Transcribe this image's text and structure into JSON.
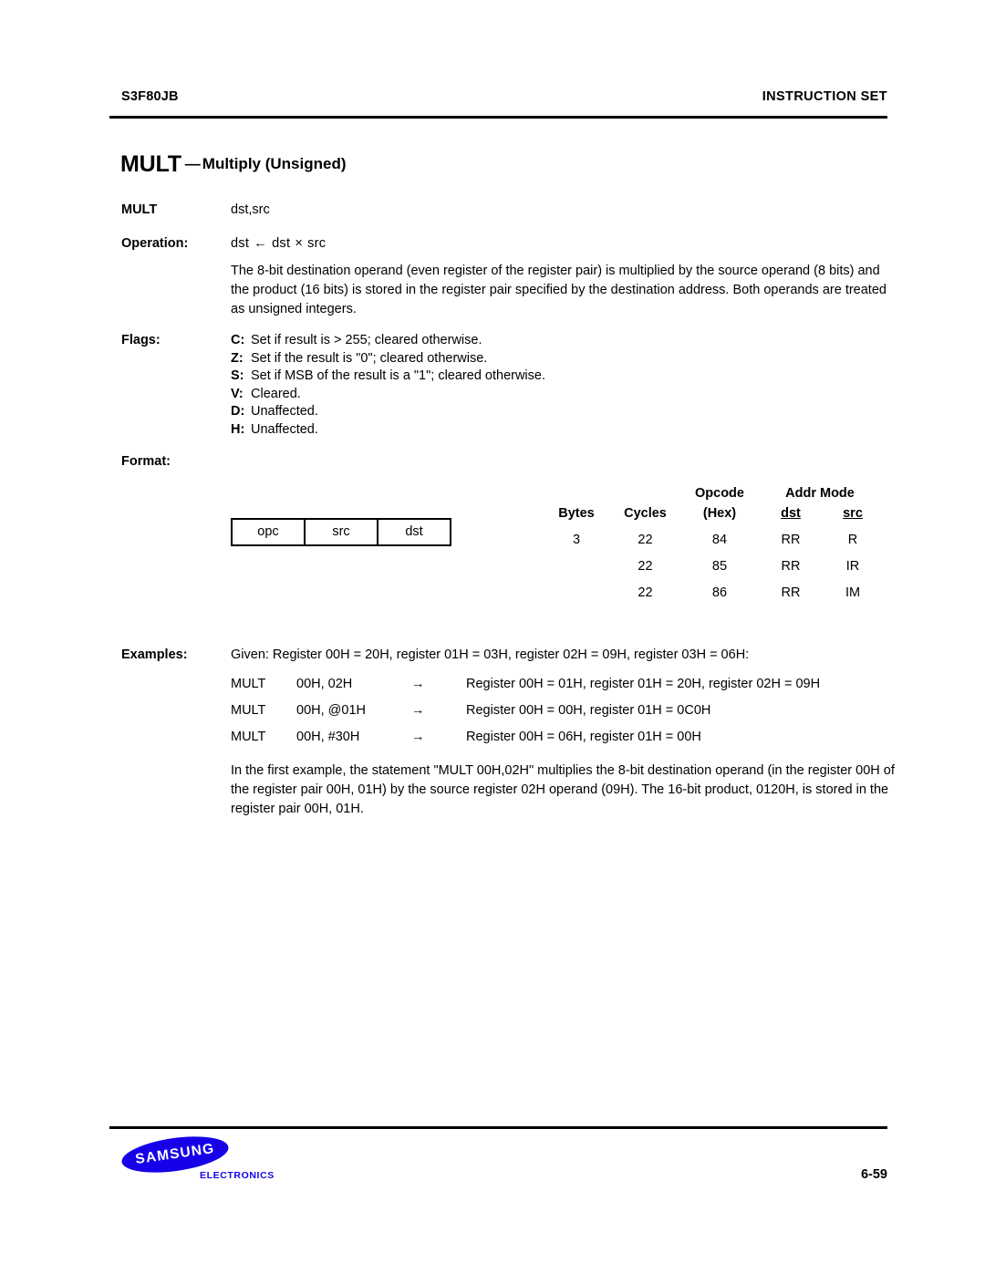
{
  "header": {
    "left": "S3F80JB",
    "right": "INSTRUCTION SET"
  },
  "title": {
    "mnemonic": "MULT",
    "dash": "—",
    "longname": "Multiply (Unsigned)"
  },
  "syntax": {
    "label": "MULT",
    "operands": "dst,src"
  },
  "operation": {
    "label": "Operation:",
    "dst": "dst",
    "assign_symbol": "←",
    "left_operand": "dst",
    "mul_symbol": "×",
    "right_operand": "src",
    "description": "The 8-bit destination operand (even register of the register pair) is multiplied by the source operand (8 bits) and the product (16 bits) is stored in the register pair specified by the destination address. Both operands are treated as unsigned integers."
  },
  "flags": {
    "label": "Flags:",
    "items": [
      {
        "key": "C:",
        "text": "Set if result is  > 255; cleared otherwise."
      },
      {
        "key": "Z:",
        "text": "Set if the result is \"0\"; cleared otherwise."
      },
      {
        "key": "S:",
        "text": "Set if MSB of the result is a \"1\"; cleared otherwise."
      },
      {
        "key": "V:",
        "text": "Cleared."
      },
      {
        "key": "D:",
        "text": "Unaffected."
      },
      {
        "key": "H:",
        "text": "Unaffected."
      }
    ]
  },
  "format": {
    "label": "Format:",
    "opcode_box": [
      "opc",
      "src",
      "dst"
    ],
    "table": {
      "headers": {
        "bytes": "Bytes",
        "cycles": "Cycles",
        "opcode": "Opcode",
        "opcode_sub": "(Hex)",
        "addr_mode": "Addr Mode",
        "dst": "dst",
        "src": "src"
      },
      "rows": [
        {
          "bytes": "3",
          "cycles": "22",
          "opcode": "84",
          "dst": "RR",
          "src": "R"
        },
        {
          "bytes": "",
          "cycles": "22",
          "opcode": "85",
          "dst": "RR",
          "src": "IR"
        },
        {
          "bytes": "",
          "cycles": "22",
          "opcode": "86",
          "dst": "RR",
          "src": "IM"
        }
      ]
    }
  },
  "examples": {
    "label": "Examples:",
    "given": "Given:  Register 00H  =  20H, register 01H  =  03H, register 02H  =  09H, register 03H  =  06H:",
    "lines": [
      {
        "mnemonic": "MULT",
        "operands": "00H, 02H",
        "arrow": "→",
        "result": "Register 00H  =  01H, register 01H  =  20H, register 02H  =  09H"
      },
      {
        "mnemonic": "MULT",
        "operands": "00H, @01H",
        "arrow": "→",
        "result": "Register 00H  =  00H, register 01H  =  0C0H"
      },
      {
        "mnemonic": "MULT",
        "operands": "00H, #30H",
        "arrow": "→",
        "result": "Register 00H  =  06H, register 01H =  00H"
      }
    ],
    "closing": "In the first example, the statement \"MULT  00H,02H\" multiplies the 8-bit destination operand (in the register 00H of the register pair 00H, 01H) by the source register 02H operand (09H). The 16-bit product, 0120H, is stored in the register pair 00H, 01H."
  },
  "footer": {
    "logo_text": "SAMSUNG",
    "logo_subtext": "ELECTRONICS",
    "logo_color": "#1500E8",
    "page_number": "6-59"
  }
}
